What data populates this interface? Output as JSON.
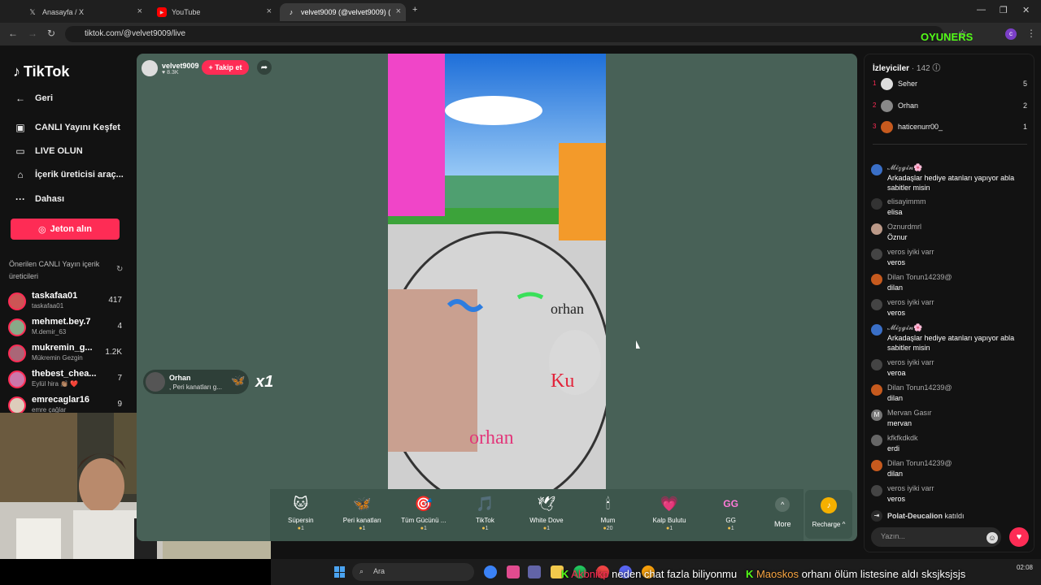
{
  "browser": {
    "tabs": [
      {
        "title": "Anasayfa / X",
        "icon": "x-logo-icon"
      },
      {
        "title": "YouTube",
        "icon": "youtube-icon"
      },
      {
        "title": "velvet9009 (@velvet9009) (",
        "icon": "tiktok-icon"
      }
    ],
    "url": "tiktok.com/@velvet9009/live"
  },
  "sidebar": {
    "logo": "TikTok",
    "back": "Geri",
    "items": [
      {
        "label": "CANLI Yayını Keşfet",
        "icon": "live-explore-icon"
      },
      {
        "label": "LIVE OLUN",
        "icon": "video-camera-icon"
      },
      {
        "label": "İçerik üreticisi araç...",
        "icon": "creator-tools-icon"
      },
      {
        "label": "Dahası",
        "icon": "more-dots-icon"
      }
    ],
    "jeton_button": "Jeton alın",
    "suggested_title": "Önerilen CANLI Yayın içerik üreticileri",
    "creators": [
      {
        "name": "taskafaa01",
        "sub": "taskafaa01",
        "count": "417"
      },
      {
        "name": "mehmet.bey.7",
        "sub": "M.demir_63",
        "count": "4"
      },
      {
        "name": "mukremin_g...",
        "sub": "Mükremin Gezgin",
        "count": "1.2K"
      },
      {
        "name": "thebest_chea...",
        "sub": "Eylül hira 👏🏽 ❤️",
        "count": "7"
      },
      {
        "name": "emrecaglar16",
        "sub": "emre çağlar",
        "count": "9"
      }
    ]
  },
  "stream": {
    "host_name": "velvet9009",
    "host_likes": "♥ 8.3K",
    "follow_label": "+ Takip et",
    "gift_popup": {
      "user": "Orhan",
      "desc": ", Peri kanatları g...",
      "combo": "x1"
    },
    "gifts": [
      {
        "name": "Süpersin",
        "price": "1",
        "icon": "🐱"
      },
      {
        "name": "Peri kanatları",
        "price": "1",
        "icon": "🦋"
      },
      {
        "name": "Tüm Gücünü ...",
        "price": "1",
        "icon": "🎯"
      },
      {
        "name": "TikTok",
        "price": "1",
        "icon": "🎵"
      },
      {
        "name": "White Dove",
        "price": "1",
        "icon": "🕊"
      },
      {
        "name": "Mum",
        "price": "20",
        "icon": "🕯"
      },
      {
        "name": "Kalp Bulutu",
        "price": "1",
        "icon": "💗"
      },
      {
        "name": "GG",
        "price": "1",
        "icon": "GG"
      }
    ],
    "more_label": "More",
    "recharge_label": "Recharge ^"
  },
  "panel": {
    "title": "İzleyiciler",
    "count": "· 142",
    "viewers": [
      {
        "rank": "1",
        "name": "Seher",
        "score": "5"
      },
      {
        "rank": "2",
        "name": "Orhan",
        "score": "2"
      },
      {
        "rank": "3",
        "name": "haticenurr00_",
        "score": "1"
      }
    ],
    "messages": [
      {
        "user": "𝓜𝓲𝔃𝓰𝓲𝓷🌸",
        "text": "Arkadaşlar hediye atanları yapıyor abla sabitler misin"
      },
      {
        "user": "elisayimmm",
        "text": "elisa"
      },
      {
        "user": "Oznurdmrl",
        "text": "Öznur"
      },
      {
        "user": "veros iyiki varr",
        "text": "veros"
      },
      {
        "user": "Dilan Torun14239@",
        "text": "dilan"
      },
      {
        "user": "veros iyiki varr",
        "text": "veros"
      },
      {
        "user": "𝓜𝓲𝔃𝓰𝓲𝓷🌸",
        "text": "Arkadaşlar hediye atanları yapıyor abla sabitler misin"
      },
      {
        "user": "veros iyiki varr",
        "text": "veroa"
      },
      {
        "user": "Dilan Torun14239@",
        "text": "dilan"
      },
      {
        "user": "Mervan Gasır",
        "text": "mervan"
      },
      {
        "user": "kfkfkdkdk",
        "text": "erdi"
      },
      {
        "user": "Dilan Torun14239@",
        "text": "dilan"
      },
      {
        "user": "veros iyiki varr",
        "text": "veros"
      }
    ],
    "join": {
      "user": "Polat-Deucalion",
      "action": "katıldı"
    },
    "input_placeholder": "Yazın..."
  },
  "taskbar": {
    "search": "Ara",
    "time": "02:08"
  },
  "ticker": {
    "user1": "Akbnikp",
    "msg1": "neden chat fazla biliyonmu",
    "user2": "Maoskos",
    "msg2": "orhanı ölüm listesine aldı sksjksjsjs"
  },
  "overlay": {
    "brand": "OYUNERS"
  },
  "colors": {
    "accent": "#fe2c55",
    "stream_bg": "#486157",
    "kick_green": "#53fc18"
  }
}
